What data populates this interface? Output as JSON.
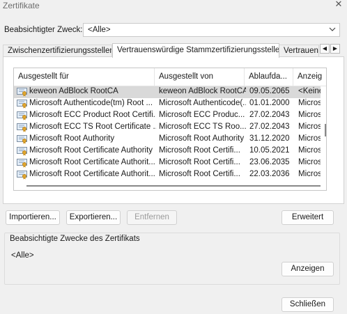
{
  "window": {
    "title": "Zertifikate",
    "close_glyph": "✕"
  },
  "purpose": {
    "label": "Beabsichtigter Zweck:",
    "value": "<Alle>"
  },
  "tabs": [
    {
      "label": "Zwischenzertifizierungsstellen",
      "active": false
    },
    {
      "label": "Vertrauenswürdige Stammzertifizierungsstellen",
      "active": true
    },
    {
      "label": "Vertrauens",
      "active": false
    }
  ],
  "tab_scroll": {
    "left": "◀",
    "right": "▶"
  },
  "table": {
    "columns": [
      "Ausgestellt für",
      "Ausgestellt von",
      "Ablaufda...",
      "Anzeig"
    ],
    "rows": [
      {
        "issued_to": "keweon AdBlock RootCA",
        "issued_by": "keweon AdBlock RootCA",
        "expires": "09.05.2065",
        "friendly": "<Keine",
        "selected": true
      },
      {
        "issued_to": "Microsoft Authenticode(tm) Root ...",
        "issued_by": "Microsoft Authenticode(...",
        "expires": "01.01.2000",
        "friendly": "Micros",
        "selected": false
      },
      {
        "issued_to": "Microsoft ECC Product Root Certifi...",
        "issued_by": "Microsoft ECC Produc...",
        "expires": "27.02.2043",
        "friendly": "Micros",
        "selected": false
      },
      {
        "issued_to": "Microsoft ECC TS Root Certificate ...",
        "issued_by": "Microsoft ECC TS Roo...",
        "expires": "27.02.2043",
        "friendly": "Micros",
        "selected": false
      },
      {
        "issued_to": "Microsoft Root Authority",
        "issued_by": "Microsoft Root Authority",
        "expires": "31.12.2020",
        "friendly": "Micros",
        "selected": false
      },
      {
        "issued_to": "Microsoft Root Certificate Authority",
        "issued_by": "Microsoft Root Certifi...",
        "expires": "10.05.2021",
        "friendly": "Micros",
        "selected": false
      },
      {
        "issued_to": "Microsoft Root Certificate Authorit...",
        "issued_by": "Microsoft Root Certifi...",
        "expires": "23.06.2035",
        "friendly": "Micros",
        "selected": false
      },
      {
        "issued_to": "Microsoft Root Certificate Authorit...",
        "issued_by": "Microsoft Root Certifi...",
        "expires": "22.03.2036",
        "friendly": "Micros",
        "selected": false
      }
    ]
  },
  "buttons": {
    "import": "Importieren...",
    "export": "Exportieren...",
    "remove": "Entfernen",
    "advanced": "Erweitert",
    "view": "Anzeigen",
    "close": "Schließen"
  },
  "intended_purposes": {
    "title": "Beabsichtigte Zwecke des Zertifikats",
    "value": "<Alle>"
  },
  "icons": {
    "row_icon": "certificate-icon",
    "dropdown": "chevron-down-icon"
  }
}
